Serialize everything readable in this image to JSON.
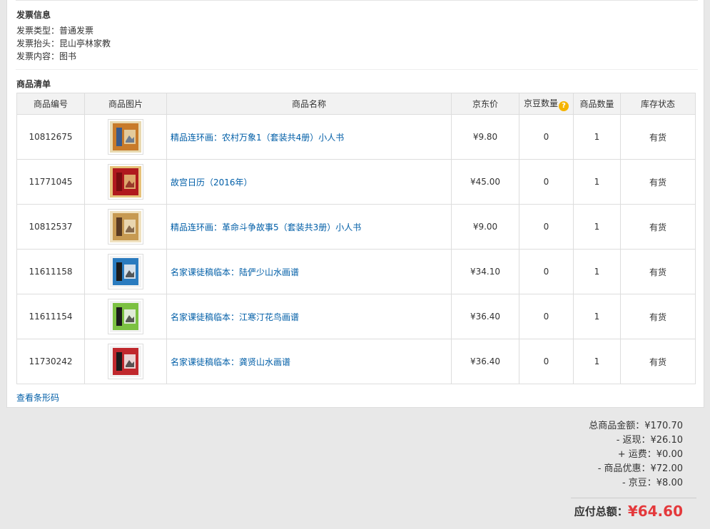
{
  "invoice": {
    "title": "发票信息",
    "type": "发票类型：普通发票",
    "header": "发票抬头：昆山亭林家教",
    "content": "发票内容：图书"
  },
  "items_section": {
    "title": "商品清单",
    "columns": [
      "商品编号",
      "商品图片",
      "商品名称",
      "京东价",
      "京豆数量",
      "商品数量",
      "库存状态"
    ],
    "help_icon": "question-icon",
    "rows": [
      {
        "id": "10812675",
        "name": "精品连环画：农村万象1（套装共4册）小人书",
        "price": "¥9.80",
        "beans": "0",
        "qty": "1",
        "stock": "有货",
        "thumb_icon": "book-cover-icon",
        "thumb_colors": [
          "#c87b2a",
          "#3a5a8a",
          "#e8d9b0"
        ]
      },
      {
        "id": "11771045",
        "name": "故宫日历（2016年）",
        "price": "¥45.00",
        "beans": "0",
        "qty": "1",
        "stock": "有货",
        "thumb_icon": "book-cover-icon",
        "thumb_colors": [
          "#b0191e",
          "#7a0d10",
          "#e6c27a"
        ]
      },
      {
        "id": "10812537",
        "name": "精品连环画：革命斗争故事5（套装共3册）小人书",
        "price": "¥9.00",
        "beans": "0",
        "qty": "1",
        "stock": "有货",
        "thumb_icon": "book-cover-icon",
        "thumb_colors": [
          "#c79a52",
          "#5a3b22",
          "#efe1c0"
        ]
      },
      {
        "id": "11611158",
        "name": "名家课徒稿临本：陆俨少山水画谱",
        "price": "¥34.10",
        "beans": "0",
        "qty": "1",
        "stock": "有货",
        "thumb_icon": "book-cover-icon",
        "thumb_colors": [
          "#2a7bbf",
          "#1b1b1b",
          "#f2f2f2"
        ]
      },
      {
        "id": "11611154",
        "name": "名家课徒稿临本：江寒汀花鸟画谱",
        "price": "¥36.40",
        "beans": "0",
        "qty": "1",
        "stock": "有货",
        "thumb_icon": "book-cover-icon",
        "thumb_colors": [
          "#7cc142",
          "#1b1b1b",
          "#f2f2f2"
        ]
      },
      {
        "id": "11730242",
        "name": "名家课徒稿临本：龚贤山水画谱",
        "price": "¥36.40",
        "beans": "0",
        "qty": "1",
        "stock": "有货",
        "thumb_icon": "book-cover-icon",
        "thumb_colors": [
          "#c0282d",
          "#1b1b1b",
          "#f2f2f2"
        ]
      }
    ],
    "barcode_link": "查看条形码"
  },
  "summary": {
    "goods_total": "总商品金额：¥170.70",
    "cashback": "- 返现：¥26.10",
    "shipping": "+ 运费：¥0.00",
    "discount": "- 商品优惠：¥72.00",
    "beans": "- 京豆：¥8.00",
    "payable_label": "应付总额：",
    "payable_amount": "¥64.60"
  },
  "colors": {
    "link": "#005ea7",
    "price": "#e4393c"
  }
}
